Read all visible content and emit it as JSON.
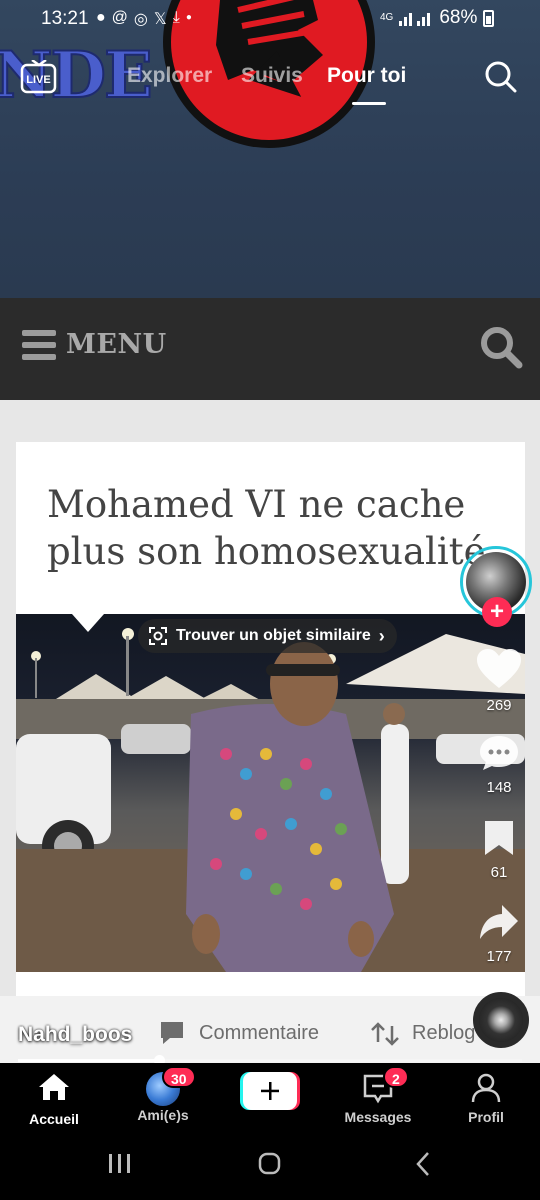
{
  "status_bar": {
    "time": "13:21",
    "network": "4G",
    "battery": "68%"
  },
  "top_nav": {
    "live_label": "LIVE",
    "tabs": [
      {
        "label": "Explorer",
        "active": false
      },
      {
        "label": "Suivis",
        "active": false
      },
      {
        "label": "Pour toi",
        "active": true
      }
    ]
  },
  "video": {
    "site_banner_text": "NDE",
    "site_menu_label": "MENU",
    "article_title": "Mohamed VI ne cache plus son homosexualité",
    "lens_label": "Trouver un objet similaire"
  },
  "right_rail": {
    "likes": "269",
    "comments": "148",
    "saves": "61",
    "shares": "177"
  },
  "caption": {
    "username": "Nahd_boos",
    "comment_label": "Commentaire",
    "reblog_label": "Reblog",
    "progress": 0.28
  },
  "bottom_nav": {
    "items": [
      {
        "label": "Accueil",
        "icon": "home-icon",
        "active": true
      },
      {
        "label": "Ami(e)s",
        "icon": "friends-avatar",
        "badge": "30"
      },
      {
        "label": "",
        "icon": "create-plus-icon"
      },
      {
        "label": "Messages",
        "icon": "inbox-icon",
        "badge": "2"
      },
      {
        "label": "Profil",
        "icon": "profile-icon"
      }
    ]
  },
  "colors": {
    "accent_red": "#fe2c55",
    "accent_cyan": "#25f4ee",
    "avatar_ring": "#26c6da"
  }
}
